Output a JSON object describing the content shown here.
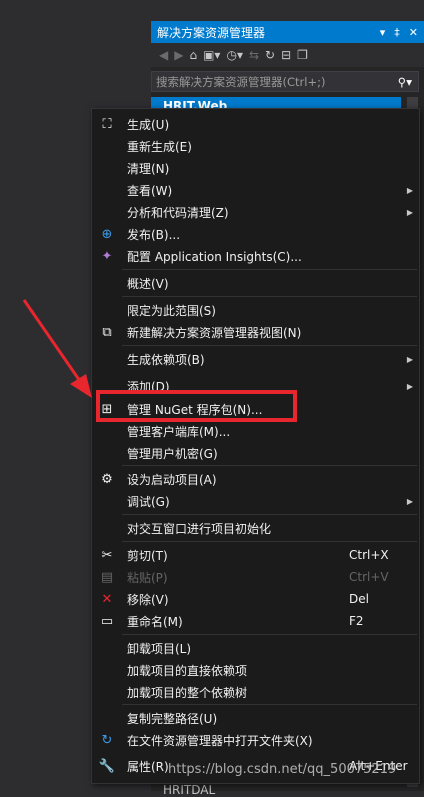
{
  "explorer": {
    "title": "解决方案资源管理器",
    "title_controls": [
      "▾",
      "‡",
      "✕"
    ],
    "search_placeholder": "搜索解决方案资源管理器(Ctrl+;)",
    "selected_project": "HRIT.Web",
    "bottom_item": "HRITDAL"
  },
  "menu": {
    "items": [
      {
        "label": "生成(U)",
        "icon": "build-icon"
      },
      {
        "label": "重新生成(E)"
      },
      {
        "label": "清理(N)"
      },
      {
        "label": "查看(W)",
        "submenu": true
      },
      {
        "label": "分析和代码清理(Z)",
        "submenu": true
      },
      {
        "label": "发布(B)...",
        "icon": "globe-icon"
      },
      {
        "label": "配置 Application Insights(C)...",
        "icon": "insights-icon"
      },
      {
        "label": "概述(V)"
      },
      {
        "label": "限定为此范围(S)"
      },
      {
        "label": "新建解决方案资源管理器视图(N)",
        "icon": "new-view-icon"
      },
      {
        "label": "生成依赖项(B)",
        "submenu": true
      },
      {
        "label": "添加(D)",
        "submenu": true
      },
      {
        "label": "管理 NuGet 程序包(N)...",
        "icon": "nuget-icon"
      },
      {
        "label": "管理客户端库(M)..."
      },
      {
        "label": "管理用户机密(G)"
      },
      {
        "label": "设为启动项目(A)",
        "icon": "gear-icon"
      },
      {
        "label": "调试(G)",
        "submenu": true
      },
      {
        "label": "对交互窗口进行项目初始化"
      },
      {
        "label": "剪切(T)",
        "shortcut": "Ctrl+X",
        "icon": "scissors-icon"
      },
      {
        "label": "粘贴(P)",
        "shortcut": "Ctrl+V",
        "icon": "paste-icon",
        "disabled": true
      },
      {
        "label": "移除(V)",
        "shortcut": "Del",
        "icon": "remove-icon"
      },
      {
        "label": "重命名(M)",
        "shortcut": "F2",
        "icon": "rename-icon"
      },
      {
        "label": "卸载项目(L)"
      },
      {
        "label": "加载项目的直接依赖项"
      },
      {
        "label": "加载项目的整个依赖树"
      },
      {
        "label": "复制完整路径(U)"
      },
      {
        "label": "在文件资源管理器中打开文件夹(X)",
        "icon": "open-folder-icon"
      },
      {
        "label": "属性(R)",
        "shortcut": "Alt+Enter",
        "icon": "wrench-icon"
      }
    ]
  },
  "watermark": "https://blog.csdn.net/qq_50075219",
  "colors": {
    "accent": "#007acc",
    "highlight": "#e8262d",
    "menu_bg": "#1b1b1c"
  }
}
